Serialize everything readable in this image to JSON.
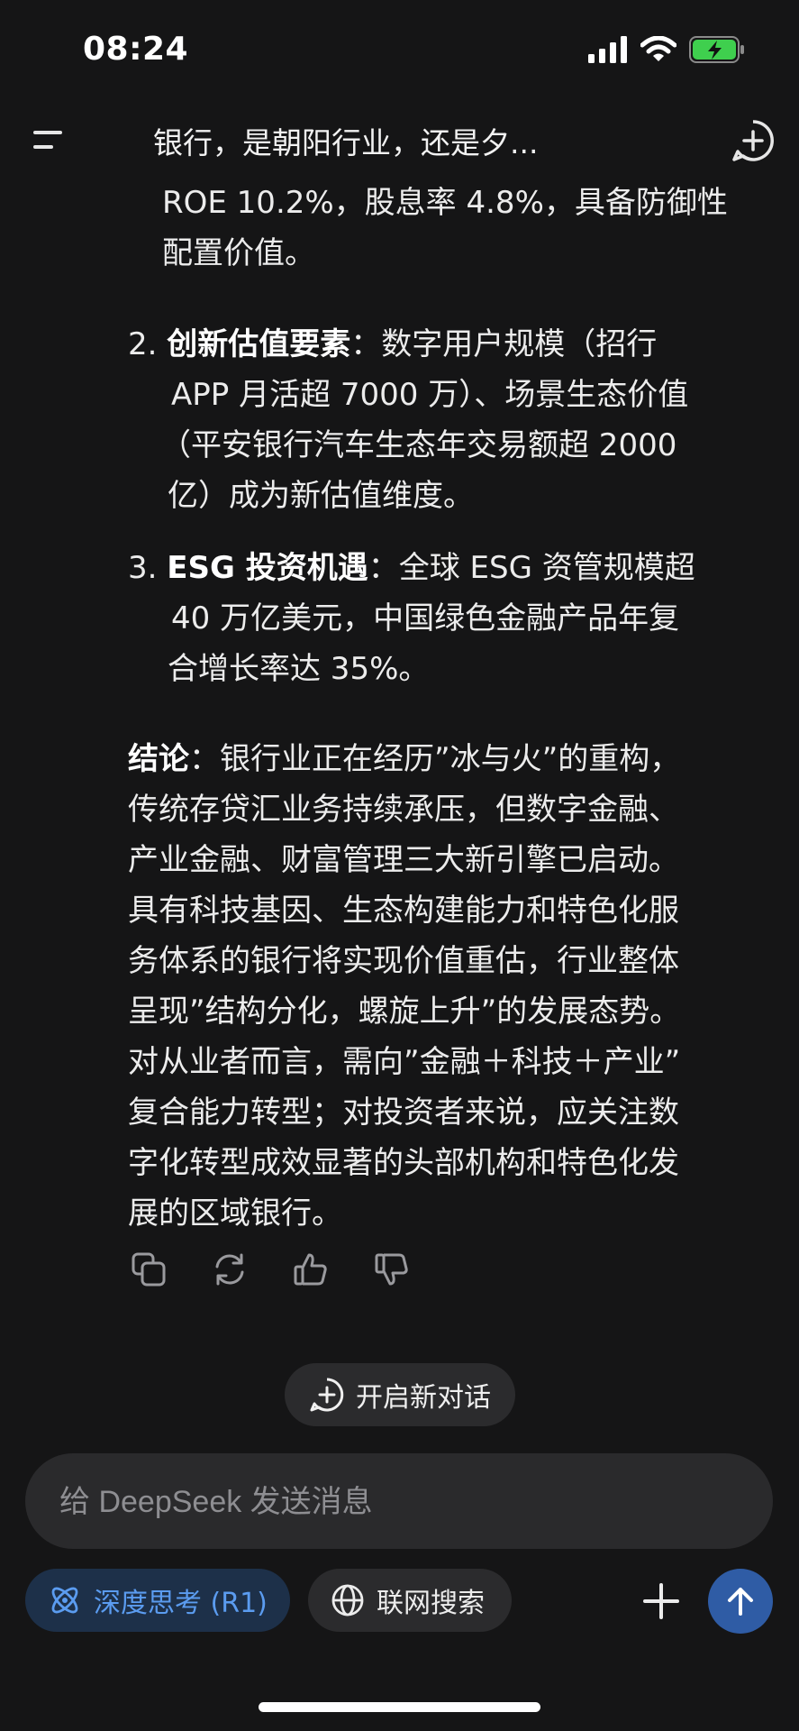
{
  "status_bar": {
    "time": "08:24"
  },
  "nav": {
    "title": "银行，是朝阳行业，还是夕..."
  },
  "message": {
    "lines": [
      "ROE 10.2%，股息率 4.8%，具备防御性",
      "配置价值。"
    ],
    "item2": {
      "number": "2.",
      "bold": "创新估值要素",
      "line1_rest": "：数字用户规模（招行",
      "line2": "APP 月活超 7000 万）、场景生态价值",
      "line3": "（平安银行汽车生态年交易额超 2000",
      "line4": "亿）成为新估值维度。"
    },
    "item3": {
      "number": "3.",
      "bold": "ESG 投资机遇",
      "line1_rest": "：全球 ESG 资管规模超",
      "line2": "40 万亿美元，中国绿色金融产品年复",
      "line3": "合增长率达 35%。"
    },
    "conclusion": {
      "bold": "结论",
      "line1_rest": "：银行业正在经历”冰与火”的重构，",
      "lines": [
        "传统存贷汇业务持续承压，但数字金融、",
        "产业金融、财富管理三大新引擎已启动。",
        "具有科技基因、生态构建能力和特色化服",
        "务体系的银行将实现价值重估，行业整体",
        "呈现”结构分化，螺旋上升”的发展态势。",
        "对从业者而言，需向”金融＋科技＋产业”",
        "复合能力转型；对投资者来说，应关注数",
        "字化转型成效显著的头部机构和特色化发",
        "展的区域银行。"
      ]
    }
  },
  "actions": [
    "copy-icon",
    "regenerate-icon",
    "thumbs-up-icon",
    "thumbs-down-icon"
  ],
  "new_dialog_label": "开启新对话",
  "input": {
    "placeholder": "给 DeepSeek 发送消息"
  },
  "chips": {
    "deep_think": "深度思考 (R1)",
    "web_search": "联网搜索"
  },
  "colors": {
    "background": "#151516",
    "accent": "#2f5ca5",
    "deep_chip_text": "#5b9cf0"
  }
}
